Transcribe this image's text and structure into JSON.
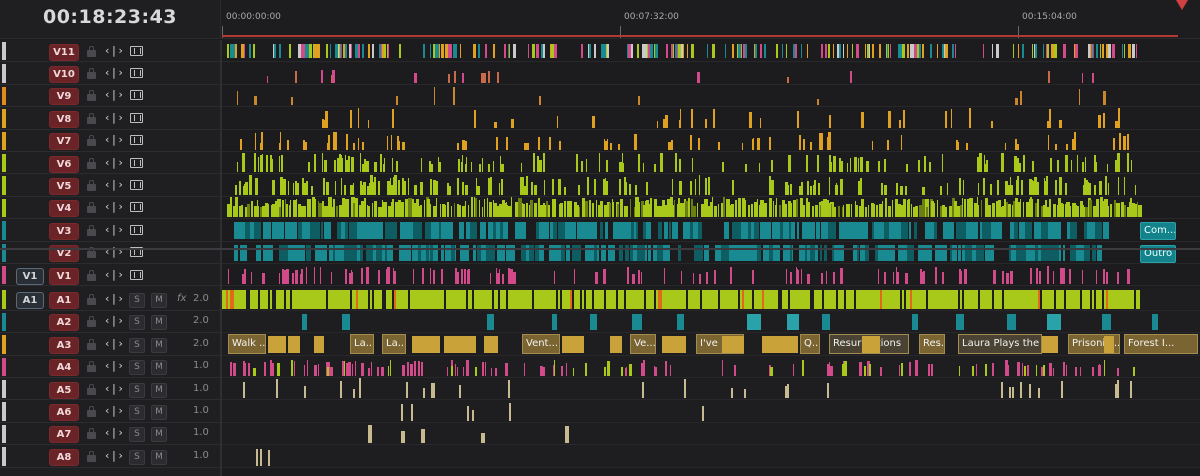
{
  "timecode": "00:18:23:43",
  "ruler": {
    "labels": [
      "00:00:00:00",
      "00:07:32:00",
      "00:15:04:00"
    ]
  },
  "video_tracks": [
    {
      "name": "V11",
      "color": "#c9c9c9"
    },
    {
      "name": "V10",
      "color": "#c9c9c9"
    },
    {
      "name": "V9",
      "color": "#e08a1e"
    },
    {
      "name": "V8",
      "color": "#e0a020"
    },
    {
      "name": "V7",
      "color": "#e0a020"
    },
    {
      "name": "V6",
      "color": "#a8c81a"
    },
    {
      "name": "V5",
      "color": "#a8c81a"
    },
    {
      "name": "V4",
      "color": "#a8c81a"
    },
    {
      "name": "V3",
      "color": "#1a8a92"
    },
    {
      "name": "V2",
      "color": "#1a8a92"
    },
    {
      "name": "V1",
      "color": "#d24a8a",
      "patch": "V1"
    }
  ],
  "audio_tracks": [
    {
      "name": "A1",
      "color": "#a8c81a",
      "patch": "A1",
      "solo": "S",
      "mute": "M",
      "fx": "fx",
      "level": "2.0"
    },
    {
      "name": "A2",
      "color": "#1a8a92",
      "solo": "S",
      "mute": "M",
      "level": "2.0"
    },
    {
      "name": "A3",
      "color": "#e0a020",
      "solo": "S",
      "mute": "M",
      "level": "2.0"
    },
    {
      "name": "A4",
      "color": "#d24a8a",
      "solo": "S",
      "mute": "M",
      "level": "1.0"
    },
    {
      "name": "A5",
      "color": "#c9c9c9",
      "solo": "S",
      "mute": "M",
      "level": "1.0"
    },
    {
      "name": "A6",
      "color": "#c9c9c9",
      "solo": "S",
      "mute": "M",
      "level": "1.0"
    },
    {
      "name": "A7",
      "color": "#c9c9c9",
      "solo": "S",
      "mute": "M",
      "level": "1.0"
    },
    {
      "name": "A8",
      "color": "#c9c9c9",
      "solo": "S",
      "mute": "M",
      "level": "1.0"
    }
  ],
  "audio_clip_labels": [
    "Walk ...",
    "La...",
    "La...",
    "Vent...",
    "Ve...",
    "I've Bee...",
    "Q...",
    "Resurrections",
    "Res...",
    "Laura Plays the ...",
    "Prisonic...",
    "Forest I..."
  ],
  "video_clip_labels": {
    "v3": "Com...",
    "v2": "Outro"
  },
  "icons": {
    "lock": "lock-icon",
    "trim": "trim-icon",
    "film": "film-icon",
    "playhead": "playhead-marker"
  },
  "colors": {
    "lime": "#a8c81a",
    "teal": "#1a8a92",
    "orange": "#e0a020",
    "pink": "#d24a8a",
    "beige": "#c7b990",
    "track_name_bg": "#6a2326"
  }
}
